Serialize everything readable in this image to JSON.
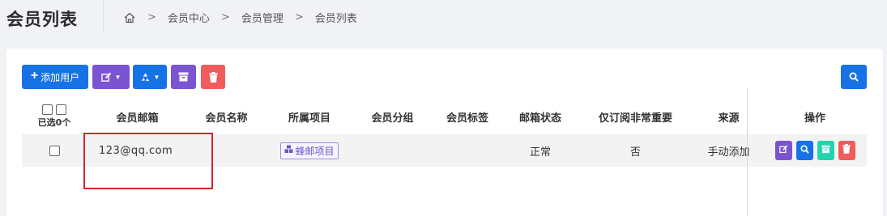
{
  "page": {
    "title": "会员列表"
  },
  "breadcrumb": {
    "items": [
      "会员中心",
      "会员管理",
      "会员列表"
    ]
  },
  "toolbar": {
    "add_label": "添加用户"
  },
  "table": {
    "headers": [
      "会员邮箱",
      "会员名称",
      "所属项目",
      "会员分组",
      "会员标签",
      "邮箱状态",
      "仅订阅非常重要",
      "来源",
      "操作"
    ],
    "select_count": "已选0个",
    "rows": [
      {
        "email": "123@qq.com",
        "name": "",
        "project": "蜂邮项目",
        "group": "",
        "tag": "",
        "email_status": "正常",
        "important_only": "否",
        "source": "手动添加"
      }
    ]
  },
  "colors": {
    "primary": "#1772e6",
    "purple": "#7b54d1",
    "danger": "#f05b5b",
    "teal": "#22d3b0",
    "highlight": "#d8262b"
  }
}
